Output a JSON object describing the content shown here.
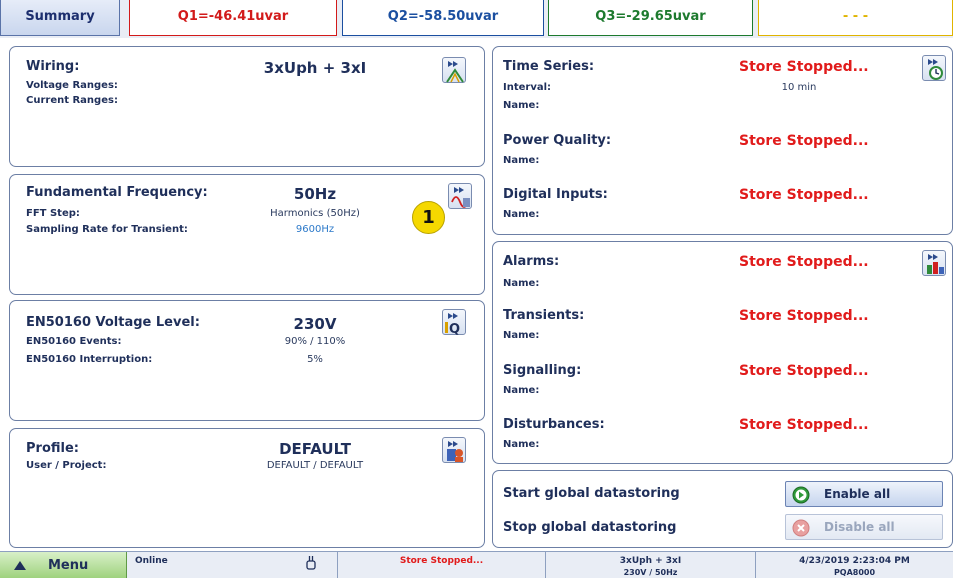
{
  "tabs": {
    "summary": "Summary",
    "q1": "Q1=-46.41uvar",
    "q2": "Q2=-58.50uvar",
    "q3": "Q3=-29.65uvar",
    "q4": "- - -"
  },
  "wiring": {
    "title": "Wiring:",
    "value": "3xUph + 3xI",
    "voltage_ranges_label": "Voltage Ranges:",
    "current_ranges_label": "Current Ranges:"
  },
  "frequency": {
    "title": "Fundamental Frequency:",
    "value": "50Hz",
    "fft_step_label": "FFT Step:",
    "fft_step_value": "Harmonics (50Hz)",
    "sampling_label": "Sampling Rate for Transient:",
    "sampling_value": "9600Hz",
    "callout": "1"
  },
  "en50160": {
    "title": "EN50160 Voltage Level:",
    "value": "230V",
    "events_label": "EN50160 Events:",
    "events_value": "90% / 110%",
    "interruption_label": "EN50160 Interruption:",
    "interruption_value": "5%"
  },
  "profile": {
    "title": "Profile:",
    "value": "DEFAULT",
    "user_label": "User / Project:",
    "user_value": "DEFAULT / DEFAULT"
  },
  "storage": {
    "time_series_title": "Time Series:",
    "time_series_status": "Store Stopped...",
    "interval_label": "Interval:",
    "interval_value": "10 min",
    "name_label": "Name:",
    "power_quality_title": "Power Quality:",
    "power_quality_status": "Store Stopped...",
    "digital_inputs_title": "Digital Inputs:",
    "digital_inputs_status": "Store Stopped..."
  },
  "events": {
    "alarms_title": "Alarms:",
    "alarms_status": "Store Stopped...",
    "transients_title": "Transients:",
    "transients_status": "Store Stopped...",
    "signalling_title": "Signalling:",
    "signalling_status": "Store Stopped...",
    "disturbances_title": "Disturbances:",
    "disturbances_status": "Store Stopped...",
    "name_label": "Name:"
  },
  "global": {
    "start_label": "Start global datastoring",
    "stop_label": "Stop global datastoring",
    "enable_all": "Enable all",
    "disable_all": "Disable all"
  },
  "statusbar": {
    "menu": "Menu",
    "online": "Online",
    "store": "Store Stopped...",
    "wiring": "3xUph + 3xI",
    "wiring_sub": "230V / 50Hz",
    "datetime": "4/23/2019 2:23:04 PM",
    "device": "PQA8000"
  },
  "colors": {
    "q1": "#d21a1a",
    "q2": "#1b4fa0",
    "q3": "#1d7a2e",
    "q4": "#e0b400",
    "stopped": "#e11b1b",
    "callout": "#f5d800"
  },
  "icons": {
    "wiring": "wiring-settings-icon",
    "frequency": "frequency-settings-icon",
    "en50160": "power-quality-settings-icon",
    "profile": "profile-settings-icon",
    "recorder": "recorder-settings-icon",
    "events": "event-settings-icon",
    "enable": "play-circle-icon",
    "disable": "cancel-circle-icon",
    "menu": "up-arrow-icon",
    "usb": "usb-icon"
  }
}
